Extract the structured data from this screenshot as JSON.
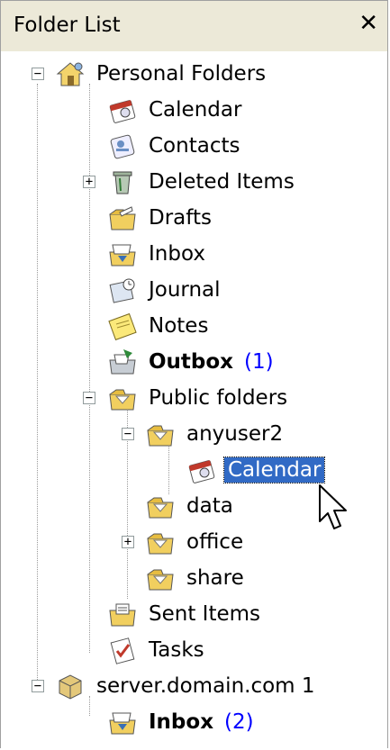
{
  "header": {
    "title": "Folder List",
    "close_glyph": "✕"
  },
  "tree": {
    "items": [
      {
        "label": "Personal Folders",
        "icon": "personal-folders-icon",
        "expander": "−"
      },
      {
        "label": "Calendar",
        "icon": "calendar-icon"
      },
      {
        "label": "Contacts",
        "icon": "contacts-icon"
      },
      {
        "label": "Deleted Items",
        "icon": "trash-icon",
        "expander": "+"
      },
      {
        "label": "Drafts",
        "icon": "drafts-icon"
      },
      {
        "label": "Inbox",
        "icon": "inbox-icon"
      },
      {
        "label": "Journal",
        "icon": "journal-icon"
      },
      {
        "label": "Notes",
        "icon": "notes-icon"
      },
      {
        "label": "Outbox",
        "icon": "outbox-icon",
        "count": "(1)",
        "bold": true
      },
      {
        "label": "Public folders",
        "icon": "folder-icon",
        "expander": "−"
      },
      {
        "label": "anyuser2",
        "icon": "folder-icon",
        "expander": "−"
      },
      {
        "label": "Calendar",
        "icon": "calendar-icon",
        "selected": true
      },
      {
        "label": "data",
        "icon": "folder-icon"
      },
      {
        "label": "office",
        "icon": "folder-icon",
        "expander": "+"
      },
      {
        "label": "share",
        "icon": "folder-icon"
      },
      {
        "label": "Sent Items",
        "icon": "sent-items-icon"
      },
      {
        "label": "Tasks",
        "icon": "tasks-icon"
      },
      {
        "label": "server.domain.com 1",
        "icon": "server-icon",
        "expander": "−"
      },
      {
        "label": "Inbox",
        "icon": "inbox-icon",
        "count": "(2)",
        "bold": true
      }
    ]
  },
  "colors": {
    "selection": "#316ac5",
    "count": "#0000ff",
    "header_bg": "#ece9d8"
  }
}
